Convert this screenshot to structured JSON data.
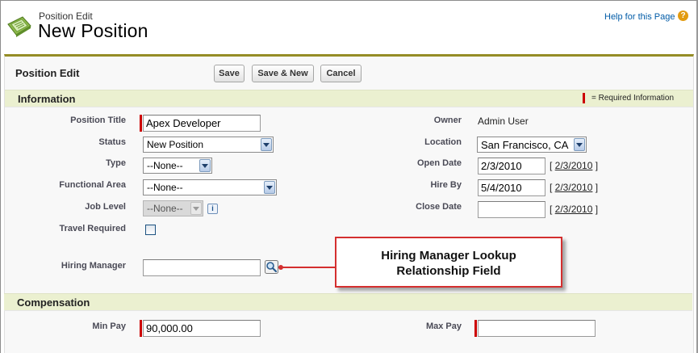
{
  "header": {
    "subtitle": "Position Edit",
    "title": "New Position",
    "help_link": "Help for this Page",
    "help_icon": "?"
  },
  "page_block": {
    "title": "Position Edit",
    "buttons": {
      "save": "Save",
      "save_new": "Save & New",
      "cancel": "Cancel"
    }
  },
  "information": {
    "section_title": "Information",
    "required_legend": "= Required Information",
    "left": {
      "position_title": {
        "label": "Position Title",
        "value": "Apex Developer"
      },
      "status": {
        "label": "Status",
        "value": "New Position"
      },
      "type": {
        "label": "Type",
        "value": "--None--"
      },
      "functional_area": {
        "label": "Functional Area",
        "value": "--None--"
      },
      "job_level": {
        "label": "Job Level",
        "value": "--None--"
      },
      "travel_required": {
        "label": "Travel Required",
        "checked": false
      },
      "hiring_manager": {
        "label": "Hiring Manager",
        "value": ""
      }
    },
    "right": {
      "owner": {
        "label": "Owner",
        "value": "Admin User"
      },
      "location": {
        "label": "Location",
        "value": "San Francisco, CA"
      },
      "open_date": {
        "label": "Open Date",
        "value": "2/3/2010",
        "today": "2/3/2010"
      },
      "hire_by": {
        "label": "Hire By",
        "value": "5/4/2010",
        "today": "2/3/2010"
      },
      "close_date": {
        "label": "Close Date",
        "value": "",
        "today": "2/3/2010"
      }
    }
  },
  "compensation": {
    "section_title": "Compensation",
    "min_pay": {
      "label": "Min Pay",
      "value": "90,000.00"
    },
    "max_pay": {
      "label": "Max Pay",
      "value": ""
    }
  },
  "callout": {
    "line1": "Hiring Manager Lookup",
    "line2": "Relationship Field",
    "border_color": "#d42f2f"
  },
  "colors": {
    "accent_bar": "#958d26",
    "section_bg": "#ebf0d0",
    "required": "#cc0000",
    "link": "#015ba7"
  },
  "icons": {
    "page_icon": "position-object-icon",
    "lookup": "magnifier-lookup-icon",
    "info": "info-icon",
    "dropdown": "chevron-down-icon"
  }
}
